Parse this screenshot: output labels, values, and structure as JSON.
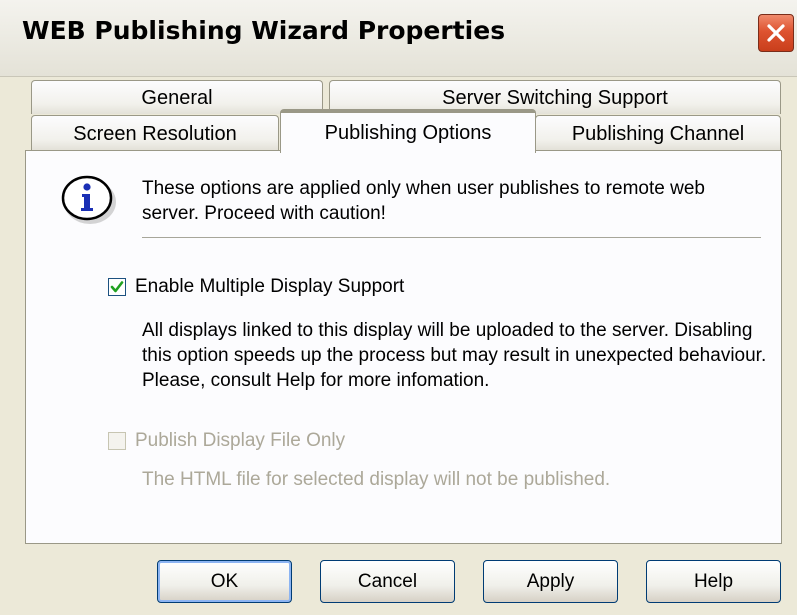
{
  "window": {
    "title": "WEB Publishing Wizard Properties"
  },
  "tabs": {
    "row1": [
      "General",
      "Server Switching Support"
    ],
    "row2": [
      "Screen Resolution",
      "Publishing Options",
      "Publishing Channel"
    ],
    "active": "Publishing Options"
  },
  "panel": {
    "info_icon": "info-icon",
    "info_text": "These options are applied only when user publishes to remote web server. Proceed with caution!",
    "options": [
      {
        "label": "Enable Multiple Display Support",
        "checked": true,
        "enabled": true,
        "description": "All displays linked to this display will be uploaded to the server. Disabling this option speeds up the process but may result in unexpected behaviour. Please, consult Help for more infomation."
      },
      {
        "label": "Publish Display File Only",
        "checked": false,
        "enabled": false,
        "description": "The HTML file for selected display will not be published."
      }
    ]
  },
  "buttons": {
    "ok": "OK",
    "cancel": "Cancel",
    "apply": "Apply",
    "help": "Help",
    "default": "OK"
  },
  "colors": {
    "active_tab_accent": "#f5a623",
    "close_button": "#de5330",
    "disabled_text": "#aca899",
    "checkmark": "#21a121"
  }
}
